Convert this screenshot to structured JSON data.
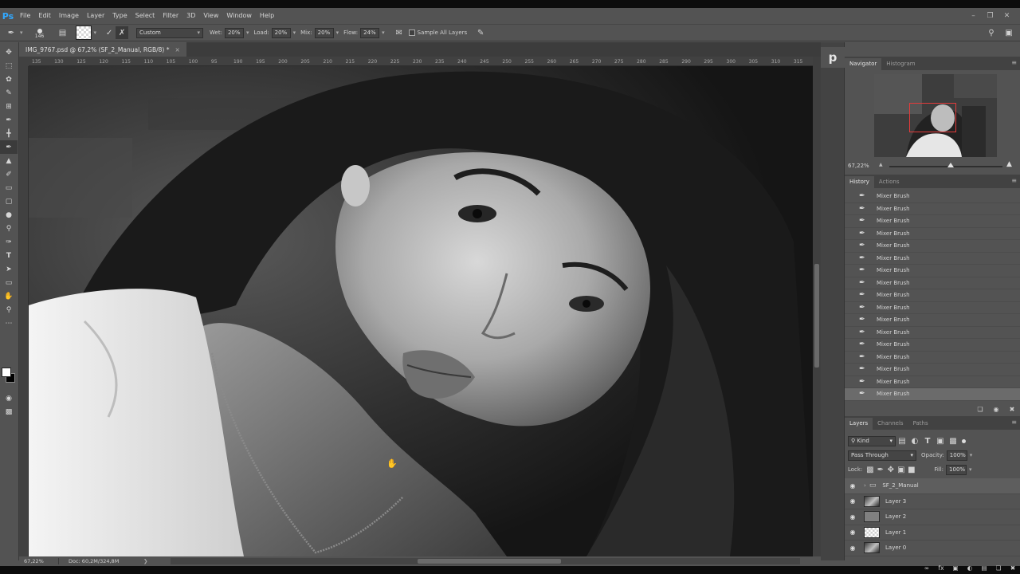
{
  "app": {
    "logo": "Ps"
  },
  "menu": [
    "File",
    "Edit",
    "Image",
    "Layer",
    "Type",
    "Select",
    "Filter",
    "3D",
    "View",
    "Window",
    "Help"
  ],
  "window_controls": [
    "minimize-icon",
    "restore-icon",
    "close-icon"
  ],
  "options": {
    "brush_size": "146",
    "mix_preset": "Custom",
    "wet_label": "Wet:",
    "wet_value": "20%",
    "load_label": "Load:",
    "load_value": "20%",
    "mix_label": "Mix:",
    "mix_value": "20%",
    "flow_label": "Flow:",
    "flow_value": "24%",
    "sample_all_layers": "Sample All Layers"
  },
  "document": {
    "tab_title": "IMG_9767.psd @ 67,2% (SF_2_Manual, RGB/8) *",
    "close": "×",
    "ruler_ticks": [
      "135",
      "130",
      "125",
      "120",
      "115",
      "110",
      "105",
      "100",
      "95",
      "190",
      "195",
      "200",
      "205",
      "210",
      "215",
      "220",
      "225",
      "230",
      "235",
      "240",
      "245",
      "250",
      "255",
      "260",
      "265",
      "270",
      "275",
      "280",
      "285",
      "290",
      "295",
      "300",
      "305",
      "310",
      "315"
    ]
  },
  "status": {
    "zoom": "67,22%",
    "doc": "Doc: 60,2M/324,8M"
  },
  "panel_strip": {
    "button": "p"
  },
  "navigator": {
    "tabs": [
      "Navigator",
      "Histogram"
    ],
    "zoom": "67,22%"
  },
  "history": {
    "tabs": [
      "History",
      "Actions"
    ],
    "items": [
      "Mixer Brush",
      "Mixer Brush",
      "Mixer Brush",
      "Mixer Brush",
      "Mixer Brush",
      "Mixer Brush",
      "Mixer Brush",
      "Mixer Brush",
      "Mixer Brush",
      "Mixer Brush",
      "Mixer Brush",
      "Mixer Brush",
      "Mixer Brush",
      "Mixer Brush",
      "Mixer Brush",
      "Mixer Brush",
      "Mixer Brush"
    ],
    "selected_index": 16
  },
  "layers": {
    "tabs": [
      "Layers",
      "Channels",
      "Paths"
    ],
    "filter_kind": "Kind",
    "blend_mode": "Pass Through",
    "opacity_label": "Opacity:",
    "opacity_value": "100%",
    "lock_label": "Lock:",
    "fill_label": "Fill:",
    "fill_value": "100%",
    "items": [
      {
        "name": "SF_2_Manual",
        "type": "group"
      },
      {
        "name": "Layer 3",
        "type": "photo"
      },
      {
        "name": "Layer 2",
        "type": "gray"
      },
      {
        "name": "Layer 1",
        "type": "transparent"
      },
      {
        "name": "Layer 0",
        "type": "photo"
      }
    ]
  },
  "colors": {
    "foreground": "#ffffff",
    "background": "#000000",
    "accent": "#31a8ff"
  }
}
